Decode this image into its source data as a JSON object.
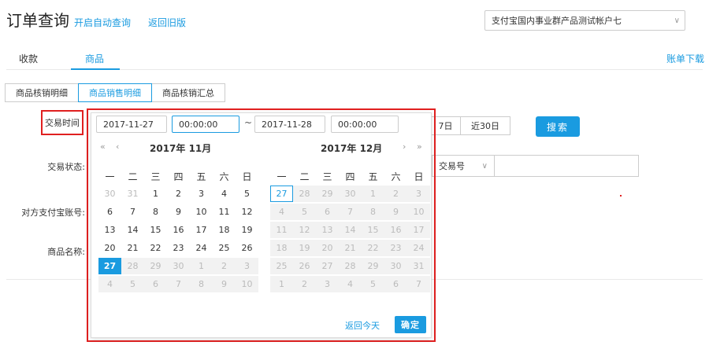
{
  "header": {
    "title": "订单查询",
    "auto_query": "开启自动查询",
    "return_old": "返回旧版",
    "account": "支付宝国内事业群产品测试帐户七",
    "account_chevron": "∨"
  },
  "tabs": {
    "receive": "收款",
    "goods": "商品",
    "download": "账单下载"
  },
  "subtabs": [
    "商品核销明细",
    "商品销售明细",
    "商品核销汇总"
  ],
  "form": {
    "trade_time": "交易时间",
    "trade_status": "交易状态:",
    "counter_account": "对方支付宝账号:",
    "goods_name": "商品名称:",
    "last7": "7日",
    "last30": "近30日",
    "search": "搜索",
    "order_type": "交易号",
    "order_chevron": "∨"
  },
  "picker": {
    "start_date": "2017-11-27",
    "start_time": "00:00:00",
    "sep": "~",
    "end_date": "2017-11-28",
    "end_time": "00:00:00",
    "nav": {
      "prev_year": "«",
      "prev_month": "‹",
      "next_month": "›",
      "next_year": "»"
    },
    "left_title": "2017年 11月",
    "right_title": "2017年 12月",
    "weekdays": [
      "一",
      "二",
      "三",
      "四",
      "五",
      "六",
      "日"
    ],
    "left_days": [
      [
        "30",
        "out"
      ],
      [
        "31",
        "out"
      ],
      [
        "1",
        ""
      ],
      [
        "2",
        ""
      ],
      [
        "3",
        ""
      ],
      [
        "4",
        ""
      ],
      [
        "5",
        ""
      ],
      [
        "6",
        ""
      ],
      [
        "7",
        ""
      ],
      [
        "8",
        ""
      ],
      [
        "9",
        ""
      ],
      [
        "10",
        ""
      ],
      [
        "11",
        ""
      ],
      [
        "12",
        ""
      ],
      [
        "13",
        ""
      ],
      [
        "14",
        ""
      ],
      [
        "15",
        ""
      ],
      [
        "16",
        ""
      ],
      [
        "17",
        ""
      ],
      [
        "18",
        ""
      ],
      [
        "19",
        ""
      ],
      [
        "20",
        ""
      ],
      [
        "21",
        ""
      ],
      [
        "22",
        ""
      ],
      [
        "23",
        ""
      ],
      [
        "24",
        ""
      ],
      [
        "25",
        ""
      ],
      [
        "26",
        ""
      ],
      [
        "27",
        "selected"
      ],
      [
        "28",
        "disabled"
      ],
      [
        "29",
        "disabled"
      ],
      [
        "30",
        "disabled"
      ],
      [
        "1",
        "disabled"
      ],
      [
        "2",
        "disabled"
      ],
      [
        "3",
        "disabled"
      ],
      [
        "4",
        "disabled"
      ],
      [
        "5",
        "disabled"
      ],
      [
        "6",
        "disabled"
      ],
      [
        "7",
        "disabled"
      ],
      [
        "8",
        "disabled"
      ],
      [
        "9",
        "disabled"
      ],
      [
        "10",
        "disabled"
      ]
    ],
    "right_days": [
      [
        "27",
        "today"
      ],
      [
        "28",
        "disabled"
      ],
      [
        "29",
        "disabled"
      ],
      [
        "30",
        "disabled"
      ],
      [
        "1",
        "disabled"
      ],
      [
        "2",
        "disabled"
      ],
      [
        "3",
        "disabled"
      ],
      [
        "4",
        "disabled"
      ],
      [
        "5",
        "disabled"
      ],
      [
        "6",
        "disabled"
      ],
      [
        "7",
        "disabled"
      ],
      [
        "8",
        "disabled"
      ],
      [
        "9",
        "disabled"
      ],
      [
        "10",
        "disabled"
      ],
      [
        "11",
        "disabled"
      ],
      [
        "12",
        "disabled"
      ],
      [
        "13",
        "disabled"
      ],
      [
        "14",
        "disabled"
      ],
      [
        "15",
        "disabled"
      ],
      [
        "16",
        "disabled"
      ],
      [
        "17",
        "disabled"
      ],
      [
        "18",
        "disabled"
      ],
      [
        "19",
        "disabled"
      ],
      [
        "20",
        "disabled"
      ],
      [
        "21",
        "disabled"
      ],
      [
        "22",
        "disabled"
      ],
      [
        "23",
        "disabled"
      ],
      [
        "24",
        "disabled"
      ],
      [
        "25",
        "disabled"
      ],
      [
        "26",
        "disabled"
      ],
      [
        "27",
        "disabled"
      ],
      [
        "28",
        "disabled"
      ],
      [
        "29",
        "disabled"
      ],
      [
        "30",
        "disabled"
      ],
      [
        "31",
        "disabled"
      ],
      [
        "1",
        "disabled"
      ],
      [
        "2",
        "disabled"
      ],
      [
        "3",
        "disabled"
      ],
      [
        "4",
        "disabled"
      ],
      [
        "5",
        "disabled"
      ],
      [
        "6",
        "disabled"
      ],
      [
        "7",
        "disabled"
      ]
    ],
    "back_today": "返回今天",
    "confirm": "确定"
  },
  "colors": {
    "accent": "#1a9be0",
    "highlight_border": "#e02020",
    "disabled_bg": "#f2f2f2"
  }
}
